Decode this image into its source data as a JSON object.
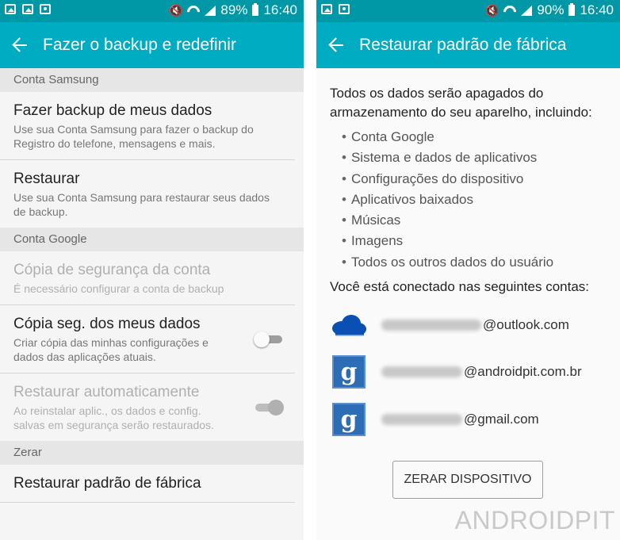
{
  "left": {
    "status": {
      "battery": "89%",
      "time": "16:40"
    },
    "title": "Fazer o backup e redefinir",
    "sections": [
      {
        "header": "Conta Samsung",
        "items": [
          {
            "title": "Fazer backup de meus dados",
            "subtitle": "Use sua Conta Samsung para fazer o backup do Registro do telefone, mensagens e mais."
          },
          {
            "title": "Restaurar",
            "subtitle": "Use sua Conta Samsung para restaurar seus dados de backup."
          }
        ]
      },
      {
        "header": "Conta Google",
        "items": [
          {
            "title": "Cópia de segurança da conta",
            "subtitle": "É necessário configurar a conta de backup"
          },
          {
            "title": "Cópia seg. dos meus dados",
            "subtitle": "Criar cópia das minhas configurações e dados das aplicações atuais."
          },
          {
            "title": "Restaurar automaticamente",
            "subtitle": "Ao reinstalar aplic., os dados e config. salvas em segurança serão restaurados."
          }
        ]
      },
      {
        "header": "Zerar",
        "items": [
          {
            "title": "Restaurar padrão de fábrica"
          }
        ]
      }
    ]
  },
  "right": {
    "status": {
      "battery": "90%",
      "time": "16:40"
    },
    "title": "Restaurar padrão de fábrica",
    "intro": "Todos os dados serão apagados do armazenamento do seu aparelho, incluindo:",
    "bullets": [
      "Conta Google",
      "Sistema e dados de aplicativos",
      "Configurações do dispositivo",
      "Aplicativos baixados",
      "Músicas",
      "Imagens",
      "Todos os outros dados do usuário"
    ],
    "connected": "Você está conectado nas seguintes contas:",
    "accounts": [
      {
        "icon": "onedrive-cloud-icon",
        "domain": "@outlook.com"
      },
      {
        "icon": "google-g-icon",
        "domain": "@androidpit.com.br"
      },
      {
        "icon": "google-g-icon",
        "domain": "@gmail.com"
      }
    ],
    "button": "ZERAR DISPOSITIVO",
    "google_letter": "g"
  },
  "watermark": "ANDROIDPIT",
  "colors": {
    "statusbar": "#0097a7",
    "appbar": "#00acc1",
    "section": "#e6e6e6",
    "google_icon": "#2d6db5",
    "onedrive": "#0a4fb3"
  }
}
